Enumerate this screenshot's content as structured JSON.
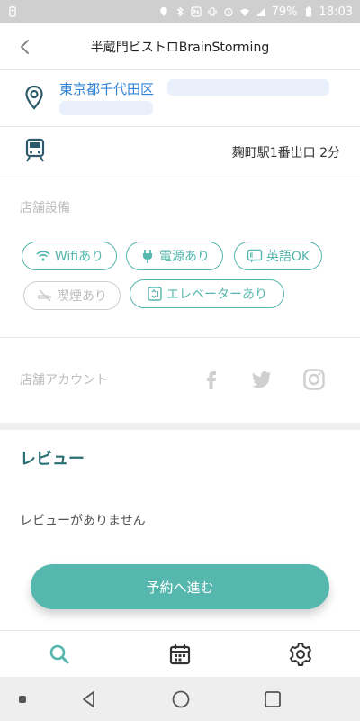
{
  "status": {
    "battery_percent": "79%",
    "time": "18:03"
  },
  "header": {
    "title": "半蔵門ビストロBrainStorming"
  },
  "shop": {
    "address": "東京都千代田区",
    "station": "麹町駅1番出口 2分"
  },
  "facilities": {
    "label": "店舗設備",
    "items": [
      {
        "label": "Wifiあり",
        "icon": "wifi-icon",
        "enabled": true
      },
      {
        "label": "電源あり",
        "icon": "power-plug-icon",
        "enabled": true
      },
      {
        "label": "英語OK",
        "icon": "english-chat-icon",
        "enabled": true
      },
      {
        "label": "喫煙あり",
        "icon": "smoking-icon",
        "enabled": false
      },
      {
        "label": "エレベーターあり",
        "icon": "elevator-icon",
        "enabled": true
      }
    ]
  },
  "account": {
    "label": "店舗アカウント",
    "socials": [
      "facebook-icon",
      "twitter-icon",
      "instagram-icon"
    ]
  },
  "review": {
    "title": "レビュー",
    "empty_text": "レビューがありません"
  },
  "cta": {
    "label": "予約へ進む"
  },
  "tabs": [
    "search-icon",
    "calendar-icon",
    "settings-icon"
  ],
  "colors": {
    "accent": "#55b7ad",
    "link": "#2f82d6",
    "header_text": "#2a6f74"
  }
}
